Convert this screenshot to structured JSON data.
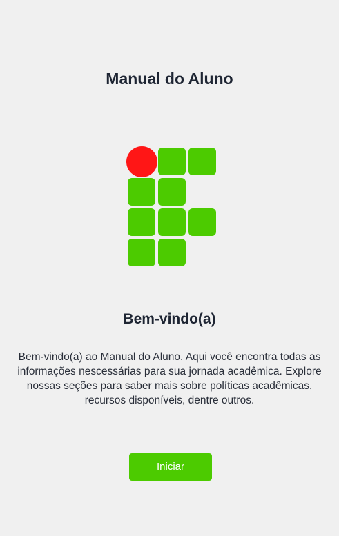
{
  "header": {
    "title": "Manual do Aluno"
  },
  "logo": {
    "icon": "institute-logo-icon",
    "colors": {
      "squares": "#4ccb00",
      "circle": "#ff1616"
    }
  },
  "welcome": {
    "heading": "Bem-vindo(a)",
    "text": "Bem-vindo(a) ao Manual do Aluno. Aqui você encontra todas as informações nescessárias para sua jornada acadêmica. Explore nossas seções para saber mais sobre políticas acadêmicas, recursos disponíveis, dentre outros."
  },
  "actions": {
    "start_label": "Iniciar"
  },
  "theme": {
    "background": "#f0f0f0",
    "accent": "#4ccb00",
    "text": "#1e2533"
  }
}
